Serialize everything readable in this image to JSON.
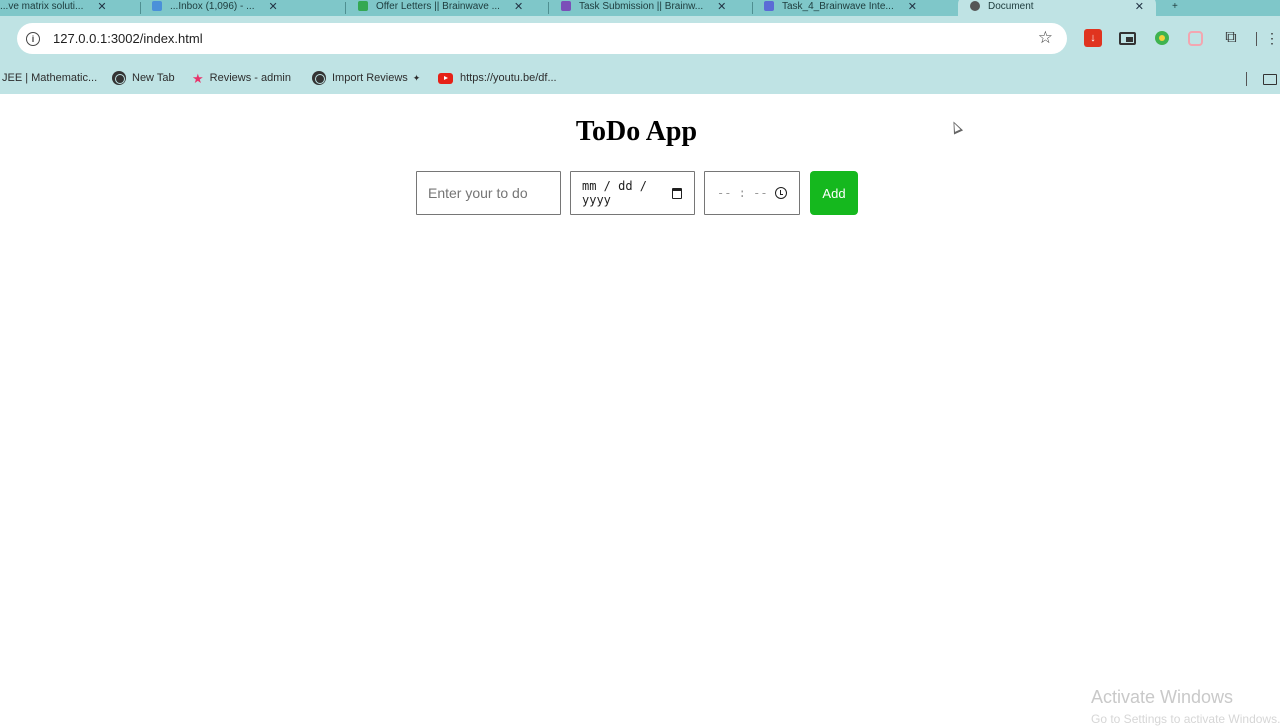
{
  "browser": {
    "tabs": [
      {
        "label": "...ve matrix soluti...",
        "color": "#7fc7c9"
      },
      {
        "label": "...Inbox (1,096) - ...",
        "color": "#4a90d9"
      },
      {
        "label": "Offer Letters || Brainwave ...",
        "color": "#34a853"
      },
      {
        "label": "Task Submission || Brainw...",
        "color": "#7b4fb8"
      },
      {
        "label": "Task_4_Brainwave Inte...",
        "color": "#5b6bd6"
      },
      {
        "label": "Document",
        "color": "#555555"
      }
    ],
    "url": "127.0.0.1:3002/index.html",
    "bookmarks": [
      {
        "label": "JEE | Mathematic..."
      },
      {
        "label": "New Tab"
      },
      {
        "label": "Reviews - admin"
      },
      {
        "label": "Import Reviews"
      },
      {
        "label": "https://youtu.be/df..."
      }
    ]
  },
  "app": {
    "title": "ToDo App",
    "task_placeholder": "Enter your to do",
    "date_placeholder": "mm / dd / yyyy",
    "time_placeholder": "-- : --",
    "add_label": "Add"
  },
  "watermark": {
    "title": "Activate Windows",
    "subtitle": "Go to Settings to activate Windows."
  }
}
